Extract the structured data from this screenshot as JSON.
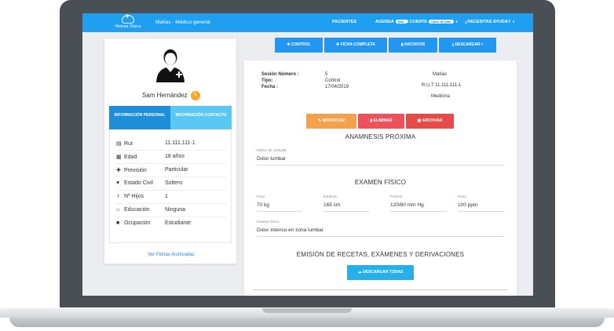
{
  "navbar": {
    "logo_text": "Historia Clinica",
    "user": "Matías - Médico general",
    "items": [
      {
        "label": "PACIENTES"
      },
      {
        "label": "AGENDA",
        "badge": "Beta"
      },
      {
        "label": "MI CUENTA",
        "badge": "Subir de plan"
      },
      {
        "label": "¿NECESITAS AYUDA?"
      }
    ]
  },
  "profile": {
    "name": "Sam Hernández",
    "tabs": [
      "INFORMACIÓN PERSONAL",
      "INFORMACIÓN CONTACTO"
    ],
    "rows": [
      {
        "icon": "id-card-icon",
        "label": "Rut",
        "value": "11.111.111-1"
      },
      {
        "icon": "calendar-icon",
        "label": "Edad",
        "value": "18 años"
      },
      {
        "icon": "plus-icon",
        "label": "Previsión",
        "value": "Particular"
      },
      {
        "icon": "heart-icon",
        "label": "Estado Civil",
        "value": "Soltero"
      },
      {
        "icon": "children-icon",
        "label": "Nº Hijos",
        "value": "1"
      },
      {
        "icon": "institution-icon",
        "label": "Educación",
        "value": "Ninguna"
      },
      {
        "icon": "briefcase-icon",
        "label": "Ocupación",
        "value": "Estudiante"
      }
    ],
    "archived_link": "Ver Fichas Archivadas"
  },
  "toolbar": {
    "control": "CONTROL",
    "ficha_completa": "FICHA COMPLETA",
    "archivos": "ARCHIVOS",
    "descargar": "DESCARGAR"
  },
  "session": {
    "numero_label": "Sesión Número :",
    "numero": "5",
    "tipo_label": "Tipo:",
    "tipo": "Control",
    "fecha_label": "Fecha :",
    "fecha": "17/04/2019",
    "doctor": "Matías",
    "rut": "R.U.T 11.111.111-1",
    "specialty": "Medicina"
  },
  "actions": {
    "modificar": "MODIFICAR",
    "eliminar": "ELIMINAR",
    "archivar": "ARCHIVAR"
  },
  "anamnesis": {
    "title": "ANAMNESIS PRÓXIMA",
    "motivo_label": "Motivo de consulta",
    "motivo_value": "Dolor lumbar"
  },
  "examen": {
    "title": "EXAMEN FÍSICO",
    "peso_label": "Peso",
    "peso": "70 kg",
    "estatura_label": "Estatura",
    "estatura": "165 cm",
    "presion_label": "Presión",
    "presion": "120/80 mm Hg",
    "pulso_label": "Pulso",
    "pulso": "100 ppm",
    "fisico_label": "Examen físico",
    "fisico": "Dolor intenso en zona lumbar"
  },
  "emision": {
    "title": "EMISIÓN DE RECETAS, EXÁMENES Y DERIVACIONES",
    "download_all": "DESCARGAR TODAS"
  },
  "colors": {
    "primary": "#2196f3",
    "modificar": "#f5a04a",
    "eliminar": "#f0505a",
    "archivar": "#e84a4a"
  }
}
